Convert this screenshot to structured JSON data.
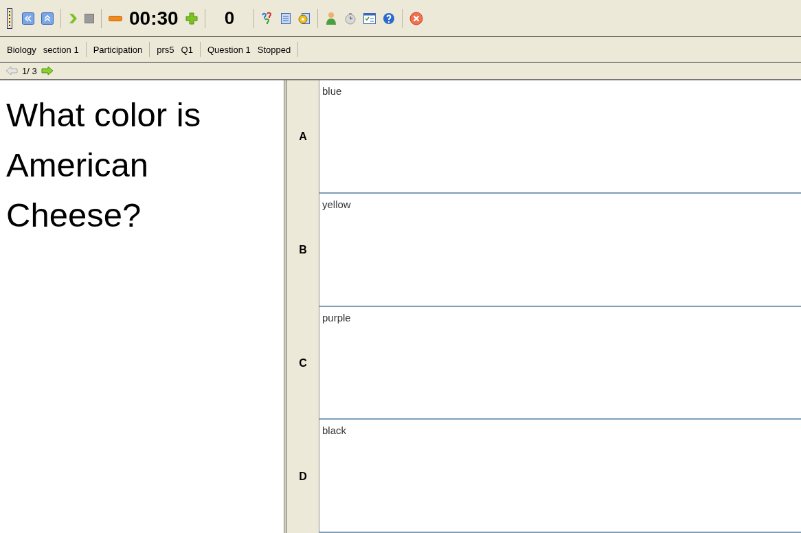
{
  "toolbar": {
    "timer": "00:30",
    "count": "0"
  },
  "status_bar": {
    "groups": [
      [
        "Biology",
        "section 1"
      ],
      [
        "Participation"
      ],
      [
        "prs5",
        "Q1"
      ],
      [
        "Question 1",
        "Stopped"
      ]
    ]
  },
  "navigation": {
    "page": "1/ 3"
  },
  "question": {
    "text": "What color is American Cheese?"
  },
  "answers": [
    {
      "letter": "A",
      "text": "blue"
    },
    {
      "letter": "B",
      "text": "yellow"
    },
    {
      "letter": "C",
      "text": "purple"
    },
    {
      "letter": "D",
      "text": "black"
    }
  ]
}
